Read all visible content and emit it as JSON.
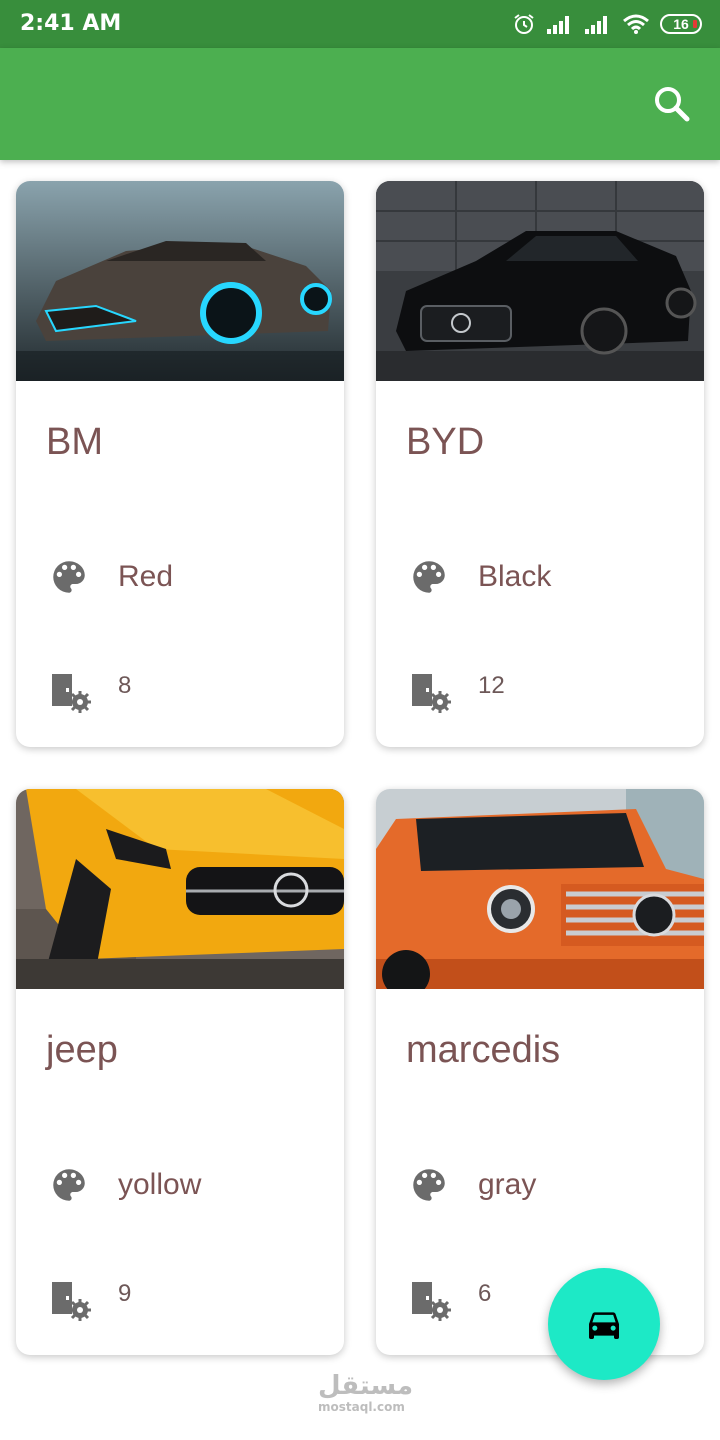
{
  "status_bar": {
    "time": "2:41 AM",
    "battery": "16",
    "icons": [
      "alarm-icon",
      "signal-icon",
      "signal-icon",
      "wifi-icon",
      "battery-icon"
    ]
  },
  "app_bar": {
    "background": "#4caf50",
    "actions": [
      "search-icon"
    ]
  },
  "cars": [
    {
      "name": "BM",
      "color": "Red",
      "doors": "8",
      "image": "neon-supercar"
    },
    {
      "name": "BYD",
      "color": "Black",
      "doors": "12",
      "image": "black-coupe"
    },
    {
      "name": "jeep",
      "color": "yollow",
      "doors": "9",
      "image": "yellow-coupe"
    },
    {
      "name": "marcedis",
      "color": "gray",
      "doors": "6",
      "image": "orange-suv"
    }
  ],
  "fab": {
    "icon": "car-icon",
    "color": "#1de9c6"
  },
  "watermark": {
    "arabic": "مستقل",
    "latin": "mostaql.com"
  }
}
